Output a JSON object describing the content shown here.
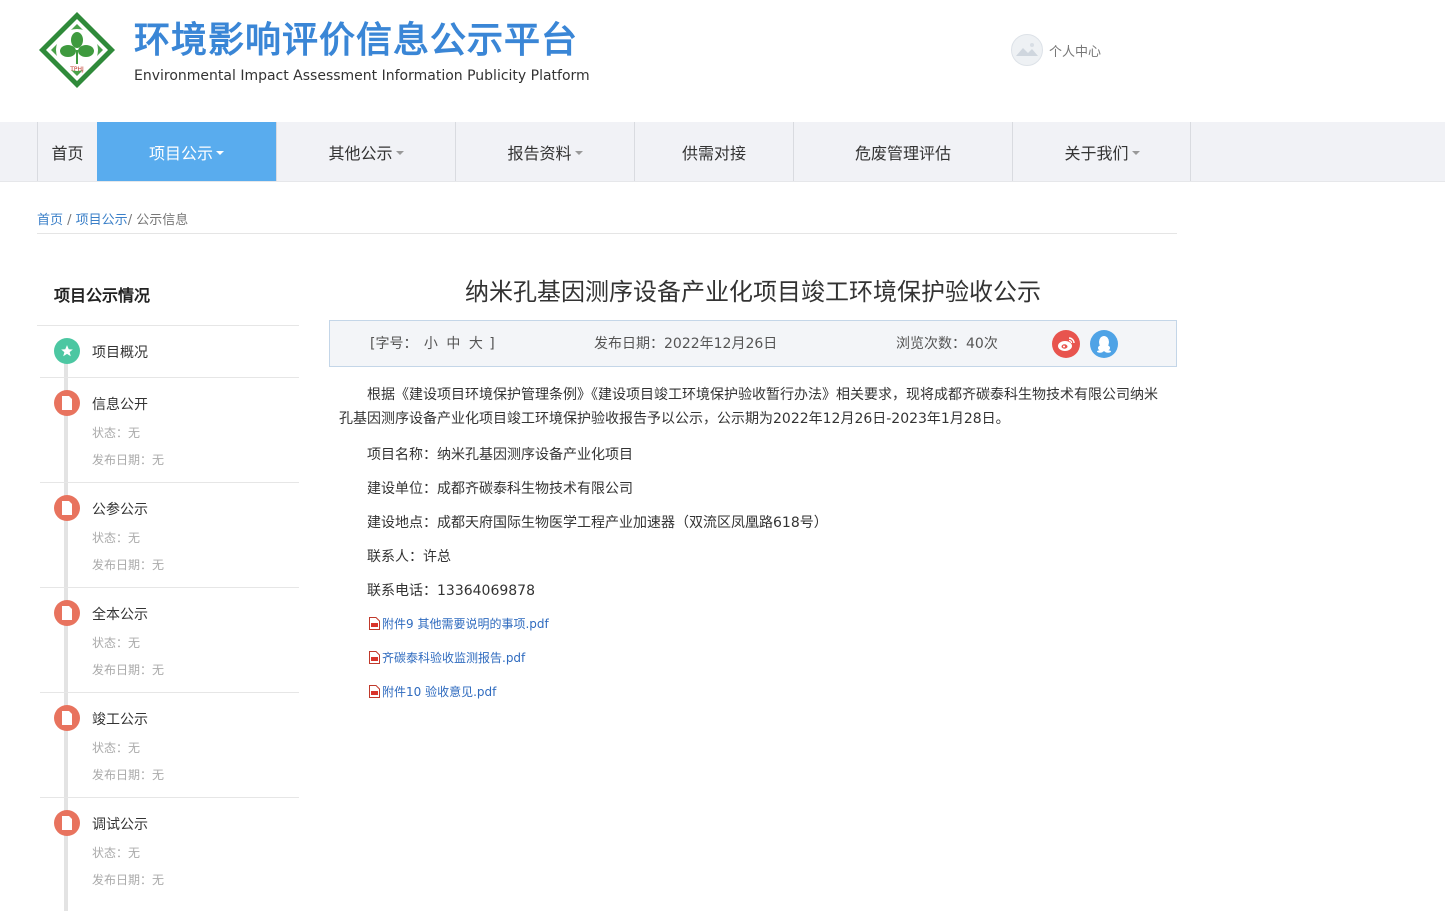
{
  "header": {
    "title": "环境影响评价信息公示平台",
    "subtitle": "Environmental Impact Assessment Information Publicity Platform",
    "logo_text": "TPHJ",
    "user_center": "个人中心"
  },
  "nav": {
    "items": [
      {
        "label": "首页",
        "dropdown": false
      },
      {
        "label": "项目公示",
        "dropdown": true,
        "active": true
      },
      {
        "label": "其他公示",
        "dropdown": true
      },
      {
        "label": "报告资料",
        "dropdown": true
      },
      {
        "label": "供需对接",
        "dropdown": false
      },
      {
        "label": "危废管理评估",
        "dropdown": false
      },
      {
        "label": "关于我们",
        "dropdown": true
      }
    ]
  },
  "breadcrumb": {
    "home": "首页",
    "sep1": " / ",
    "section": "项目公示",
    "current": "/ 公示信息"
  },
  "sidebar": {
    "title": "项目公示情况",
    "status_prefix": "状态：",
    "date_prefix": "发布日期：",
    "items": [
      {
        "label": "项目概况",
        "icon": "star-icon",
        "status": "",
        "date": ""
      },
      {
        "label": "信息公开",
        "icon": "document-icon",
        "status": "状态：无",
        "date": "发布日期：无"
      },
      {
        "label": "公参公示",
        "icon": "document-icon",
        "status": "状态：无",
        "date": "发布日期：无"
      },
      {
        "label": "全本公示",
        "icon": "document-icon",
        "status": "状态：无",
        "date": "发布日期：无"
      },
      {
        "label": "竣工公示",
        "icon": "document-icon",
        "status": "状态：无",
        "date": "发布日期：无"
      },
      {
        "label": "调试公示",
        "icon": "document-icon",
        "status": "状态：无",
        "date": "发布日期：无"
      }
    ]
  },
  "article": {
    "title": "纳米孔基因测序设备产业化项目竣工环境保护验收公示",
    "meta": {
      "font_prefix": "[字号：",
      "font_small": "小",
      "font_medium": "中",
      "font_large": "大",
      "font_suffix": "]",
      "date": "发布日期：2022年12月26日",
      "views": "浏览次数：40次"
    },
    "intro": "根据《建设项目环境保护管理条例》《建设项目竣工环境保护验收暂行办法》相关要求，现将成都齐碳泰科生物技术有限公司纳米孔基因测序设备产业化项目竣工环境保护验收报告予以公示，公示期为2022年12月26日-2023年1月28日。",
    "fields": [
      "项目名称：纳米孔基因测序设备产业化项目",
      "建设单位：成都齐碳泰科生物技术有限公司",
      "建设地点：成都天府国际生物医学工程产业加速器（双流区凤凰路618号）",
      "联系人：许总",
      "联系电话：13364069878"
    ],
    "attachments": [
      "附件9 其他需要说明的事项.pdf",
      "齐碳泰科验收监测报告.pdf",
      "附件10 验收意见.pdf"
    ]
  },
  "colors": {
    "brand_blue": "#3a86d6",
    "nav_active": "#59acee",
    "nav_bg": "#f1f2f6",
    "green_icon": "#4cc7a2",
    "red_icon": "#e8735e",
    "weibo": "#e8544e",
    "qq": "#4fa3e6",
    "link": "#2f6bbf"
  }
}
